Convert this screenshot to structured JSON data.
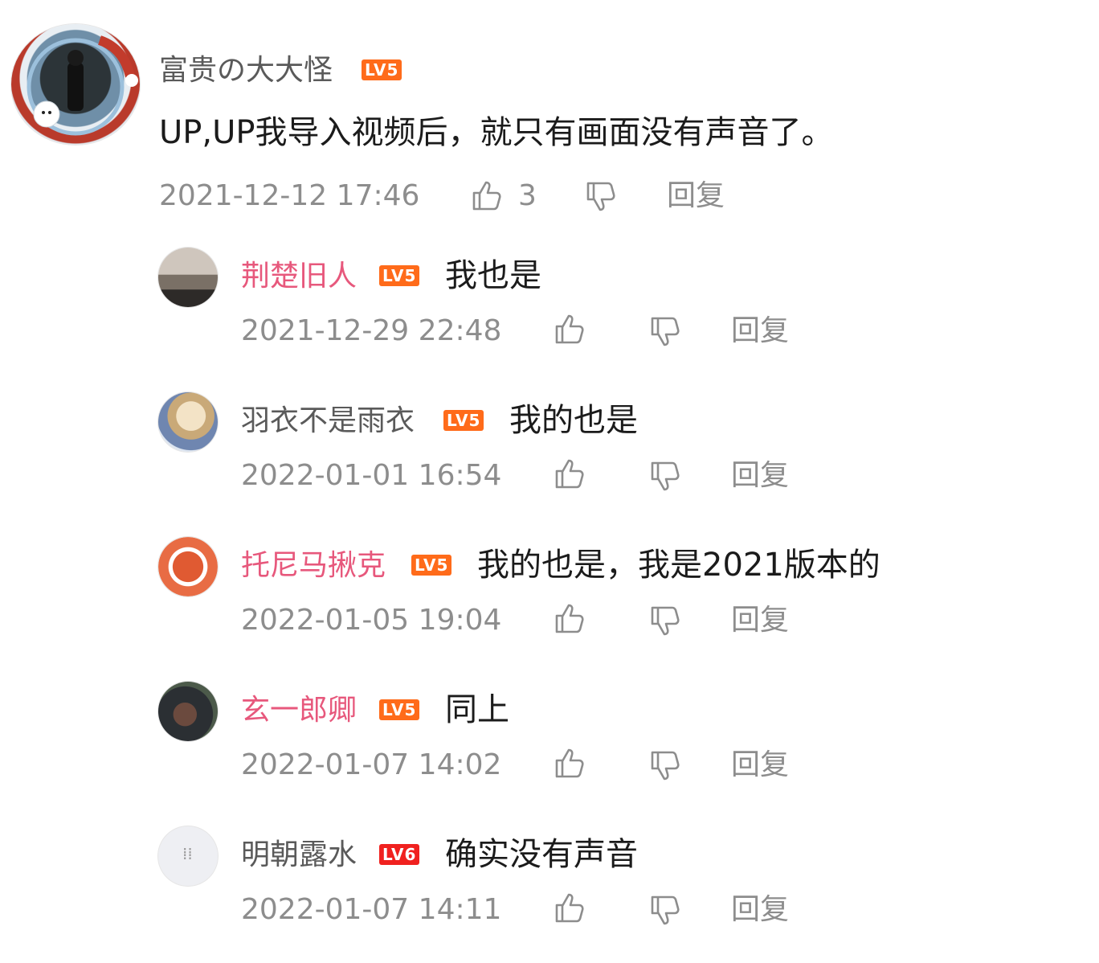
{
  "colors": {
    "pink_name": "#e7587c",
    "gray_name": "#5a5a5a",
    "level_orange": "#ff6b1a",
    "level_red": "#f0211f",
    "meta_gray": "#8d8d8d"
  },
  "main": {
    "user": "富贵の大大怪",
    "level": "LV5",
    "content": "UP,UP我导入视频后，就只有画面没有声音了。",
    "time": "2021-12-12 17:46",
    "likes": "3",
    "reply": "回复"
  },
  "replies": [
    {
      "user": "荆楚旧人",
      "level": "LV5",
      "content": "我也是",
      "time": "2021-12-29 22:48",
      "reply": "回复"
    },
    {
      "user": "羽衣不是雨衣",
      "level": "LV5",
      "content": "我的也是",
      "time": "2022-01-01 16:54",
      "reply": "回复"
    },
    {
      "user": "托尼马揪克",
      "level": "LV5",
      "content": "我的也是，我是2021版本的",
      "time": "2022-01-05 19:04",
      "reply": "回复"
    },
    {
      "user": "玄一郎卿",
      "level": "LV5",
      "content": "同上",
      "time": "2022-01-07 14:02",
      "reply": "回复"
    },
    {
      "user": "明朝露水",
      "level": "LV6",
      "content": "确实没有声音",
      "time": "2022-01-07 14:11",
      "reply": "回复"
    }
  ]
}
